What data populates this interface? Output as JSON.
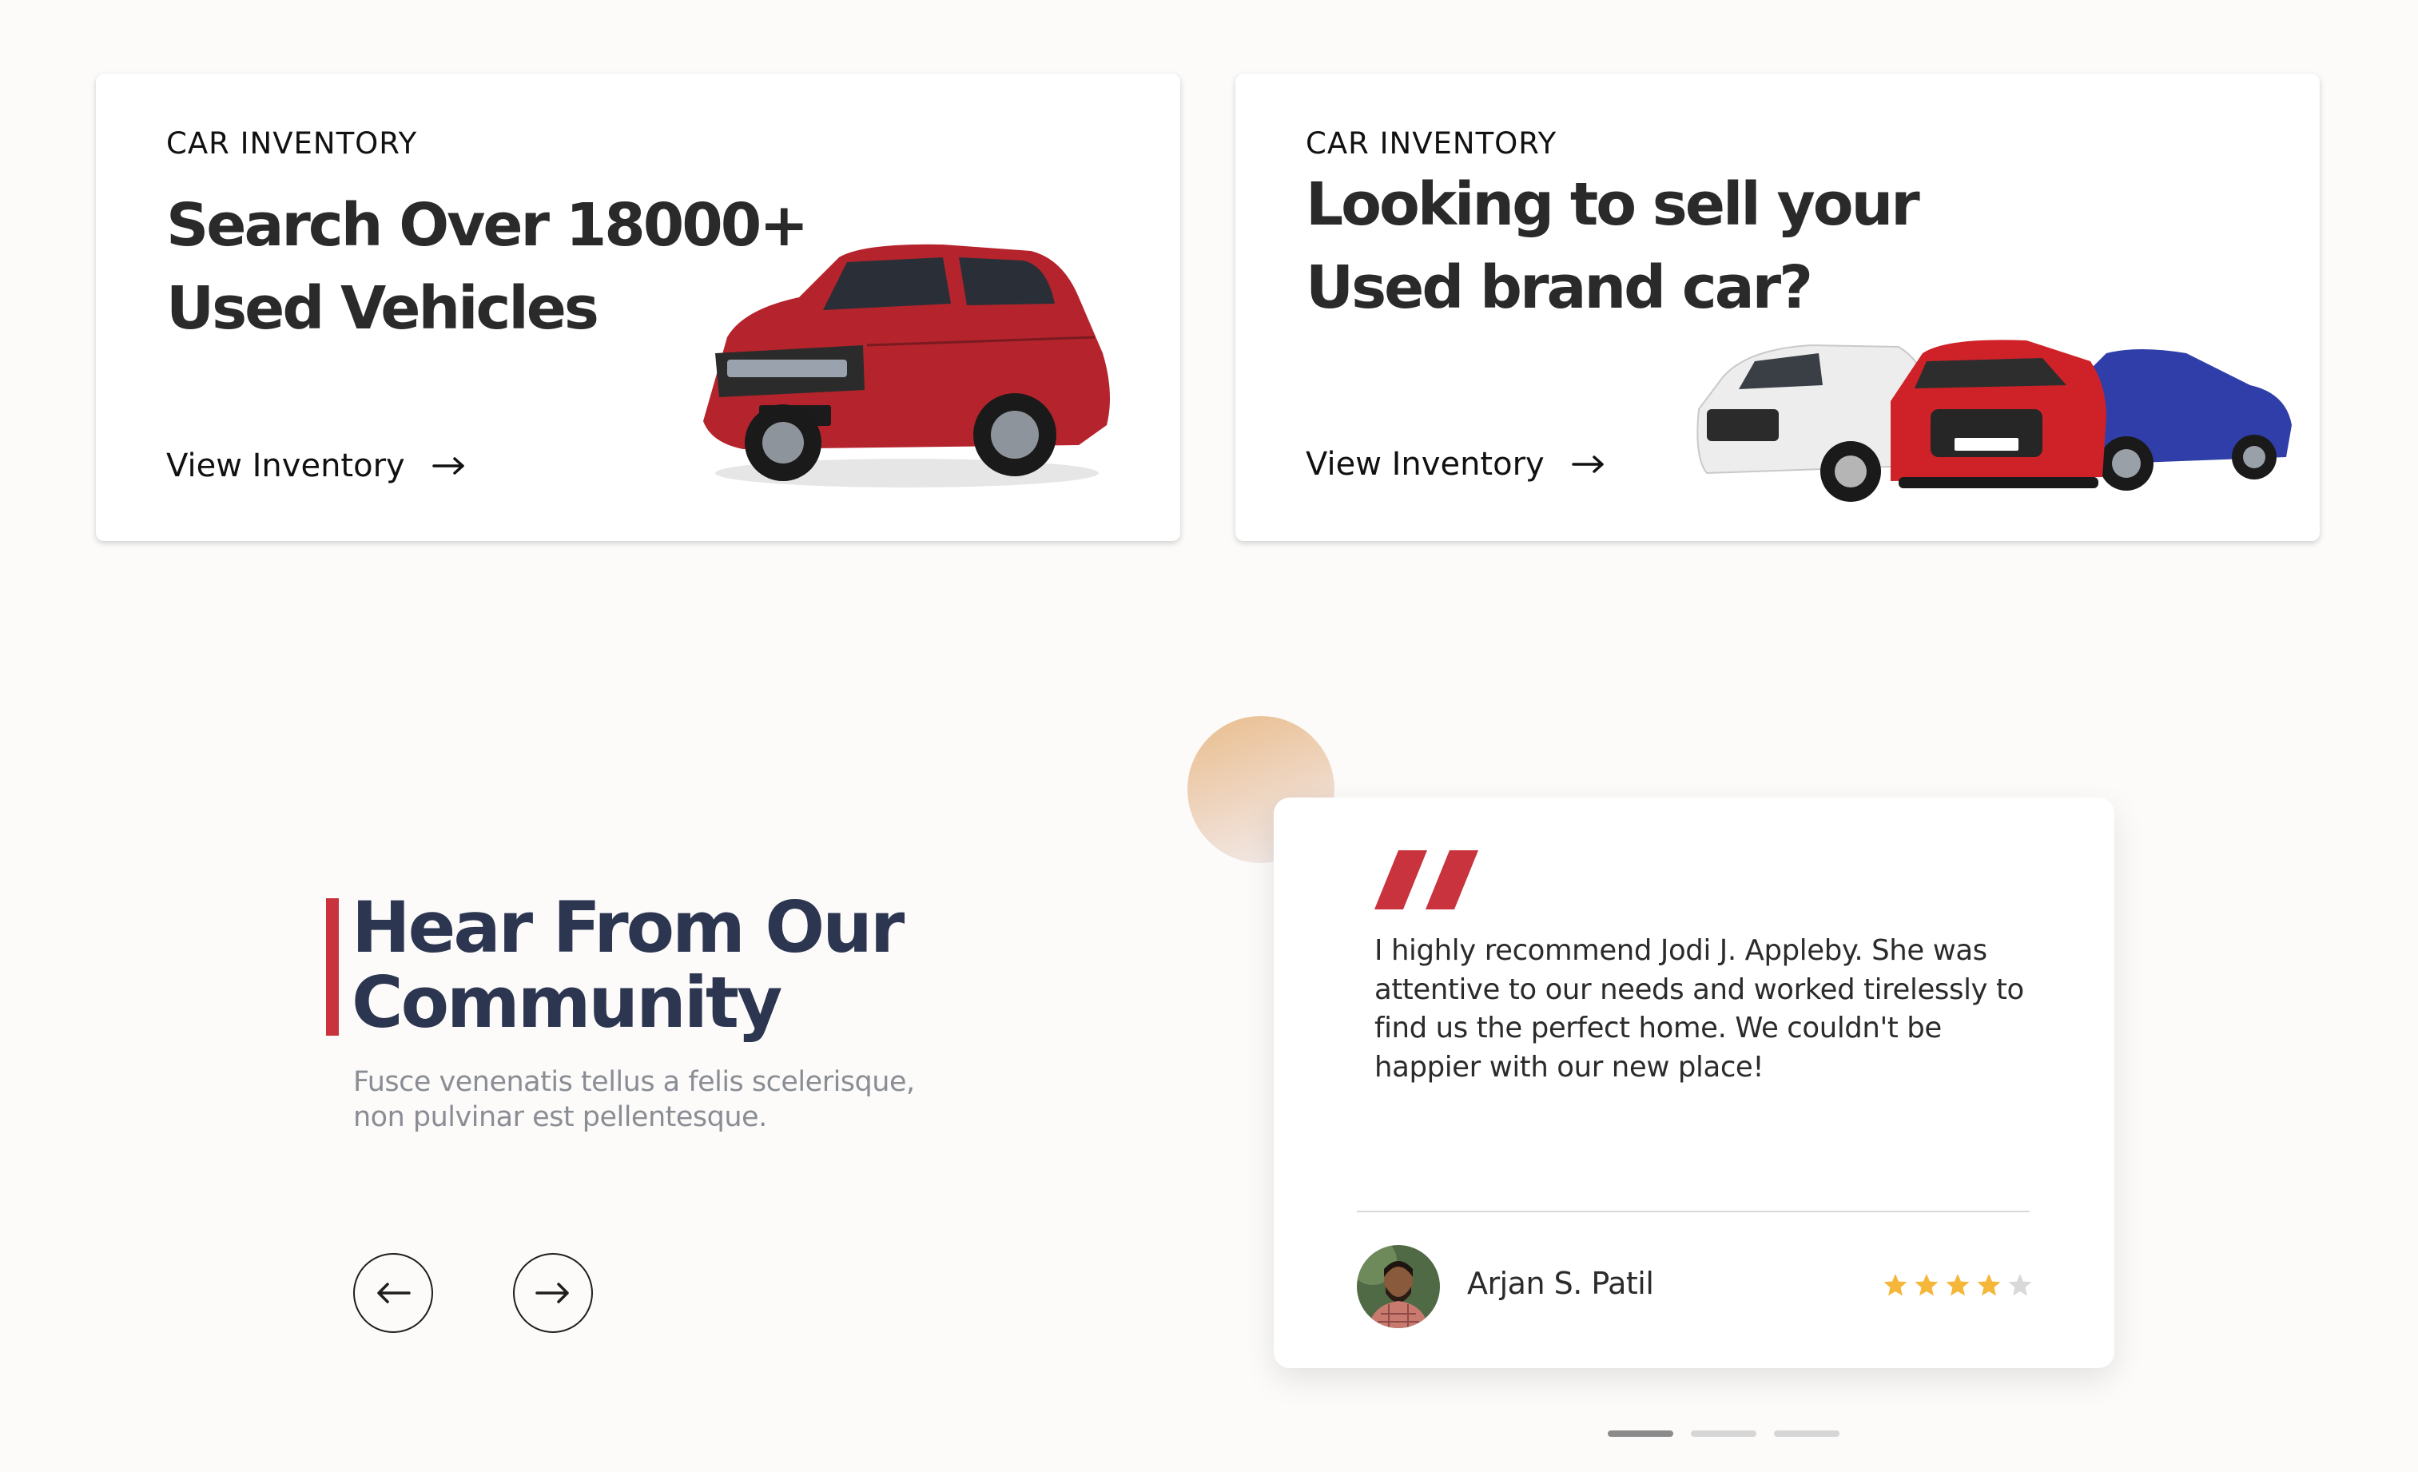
{
  "inventory_cards": [
    {
      "eyebrow": "CAR INVENTORY",
      "title_line1": "Search Over 18000+",
      "title_line2": "Used Vehicles",
      "cta_label": "View Inventory",
      "cta_icon": "arrow-right-icon"
    },
    {
      "eyebrow": "CAR INVENTORY",
      "title_line1": "Looking to sell your",
      "title_line2": "Used brand car?",
      "cta_label": "View Inventory",
      "cta_icon": "arrow-right-icon"
    }
  ],
  "testimonials": {
    "heading_line1": "Hear From Our",
    "heading_line2": "Community",
    "subheading_line1": "Fusce venenatis tellus a felis scelerisque,",
    "subheading_line2": "non pulvinar est pellentesque.",
    "prev_icon": "arrow-left-icon",
    "next_icon": "arrow-right-icon",
    "active": {
      "quote_icon": "quote-mark-icon",
      "quote_line1": "I highly recommend Jodi J. Appleby. She was",
      "quote_line2": "attentive to our needs and worked tirelessly to",
      "quote_line3": "find us the perfect home. We couldn't be",
      "quote_line4": "happier with our new place!",
      "author": "Arjan S. Patil",
      "rating": 4,
      "rating_max": 5
    },
    "slide_count": 3,
    "active_slide": 1
  },
  "colors": {
    "accent_red": "#c8333d",
    "heading_navy": "#2c3650",
    "star_gold": "#f4b73a",
    "star_empty": "#d9d9d9",
    "background": "#fcfbfa"
  }
}
